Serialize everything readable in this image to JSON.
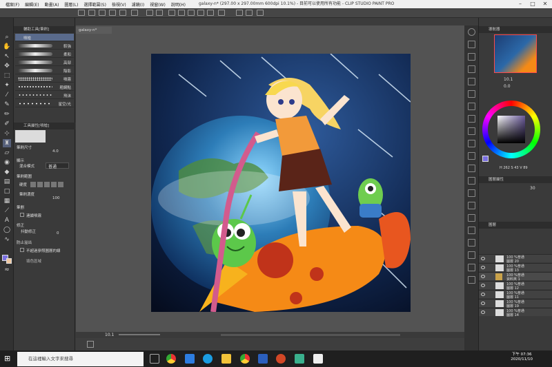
{
  "menu": [
    "檔案(F)",
    "編輯(E)",
    "動畫(A)",
    "圖層(L)",
    "選擇範圍(S)",
    "檢視(V)",
    "濾鏡(I)",
    "視窗(W)",
    "說明(H)"
  ],
  "window_title": "galaxy-n* (297.00 x 297.00mm 600dpi 10.1%)  - 目前可以使用所有功能 - CLIP STUDIO PAINT PRO",
  "tool_panel": {
    "header": "輔助工具[筆刷]",
    "brushes": [
      {
        "label": "噴槍"
      },
      {
        "label": "較強"
      },
      {
        "label": "柔和"
      },
      {
        "label": "高部"
      },
      {
        "label": "陰影"
      },
      {
        "label": "噴霧"
      },
      {
        "label": "粗網點"
      },
      {
        "label": "飛沫"
      },
      {
        "label": "星空/光"
      }
    ]
  },
  "tool_props": {
    "header": "工具屬性[噴槍]",
    "brush_size_label": "筆刷尺寸",
    "brush_size_value": "4.0",
    "display_label": "顯示",
    "blend_label": "混合模式",
    "blend_value": "普通",
    "brush_range_label": "筆刷範圍",
    "hardness_label": "硬度",
    "density_label": "筆刷濃度",
    "density_value": "100",
    "stroke_label": "筆劃",
    "stroke_opt": "連續噴霧",
    "correction_label": "修正",
    "stabilize_label": "抖動修正",
    "stabilize_value": "0",
    "overflow_label": "防止溢出",
    "overflow_opt": "不超過參照圖層的線",
    "ref_label": "填色區域"
  },
  "doc_tab": "galaxy-n*",
  "canvas_zoom": "10.1",
  "navigator": {
    "title": "導航器",
    "zoom": "10.1",
    "angle": "0.0"
  },
  "color": {
    "hsv": "H 262  S 43  V 89",
    "hue_hex": "#6a5a9a"
  },
  "layer_props": {
    "title": "圖層屬性",
    "opacity": "30"
  },
  "layers_title": "圖層",
  "layers": [
    {
      "mode": "100 %普通",
      "name": "圖層 20"
    },
    {
      "mode": "100 %普通",
      "name": "圖層 13"
    },
    {
      "mode": "100 %普通",
      "name": "資料夾 1"
    },
    {
      "mode": "100 %普通",
      "name": "圖層 12"
    },
    {
      "mode": "100 %普通",
      "name": "圖層 11"
    },
    {
      "mode": "100 %普通",
      "name": "圖層 19"
    },
    {
      "mode": "100 %普通",
      "name": "圖層 14"
    }
  ],
  "taskbar": {
    "search_placeholder": "在這裡輸入文字來搜尋",
    "time": "下午 07:36",
    "date": "2020/11/10"
  },
  "colors": {
    "accent": "#5b4fd6",
    "panel": "#3a3a3a",
    "canvas_bg": "#535353"
  }
}
